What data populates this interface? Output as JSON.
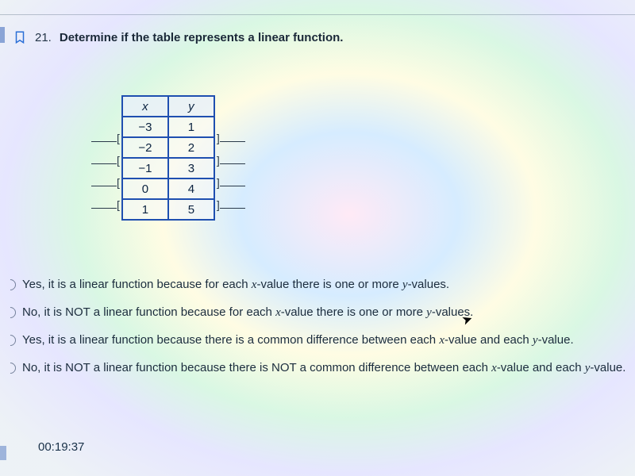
{
  "question": {
    "number": "21.",
    "prompt": "Determine if the table represents a linear function."
  },
  "table": {
    "headers": {
      "x": "x",
      "y": "y"
    },
    "rows": [
      {
        "x": "−3",
        "y": "1"
      },
      {
        "x": "−2",
        "y": "2"
      },
      {
        "x": "−1",
        "y": "3"
      },
      {
        "x": "0",
        "y": "4"
      },
      {
        "x": "1",
        "y": "5"
      }
    ]
  },
  "brackets": {
    "left": "[",
    "right": "]"
  },
  "options": {
    "a_pre": "Yes, it is a linear function because for each ",
    "a_mid": "-value there is one or more ",
    "a_post": "-values.",
    "b_pre": "No, it is NOT a linear function because for each ",
    "b_mid": "-value there is one or more ",
    "b_post": "-values.",
    "c_pre": "Yes, it is a linear function because there is a common difference between each ",
    "c_mid": "-value and each ",
    "c_post": "-value.",
    "d_pre": "No, it is NOT a linear function because there is NOT a common difference between each ",
    "d_mid": "-value and each ",
    "d_post": "-value."
  },
  "vars": {
    "x": "x",
    "y": "y"
  },
  "timer": "00:19:37",
  "chart_data": {
    "type": "table",
    "title": "Determine if the table represents a linear function.",
    "columns": [
      "x",
      "y"
    ],
    "rows": [
      [
        -3,
        1
      ],
      [
        -2,
        2
      ],
      [
        -1,
        3
      ],
      [
        0,
        4
      ],
      [
        1,
        5
      ]
    ]
  }
}
